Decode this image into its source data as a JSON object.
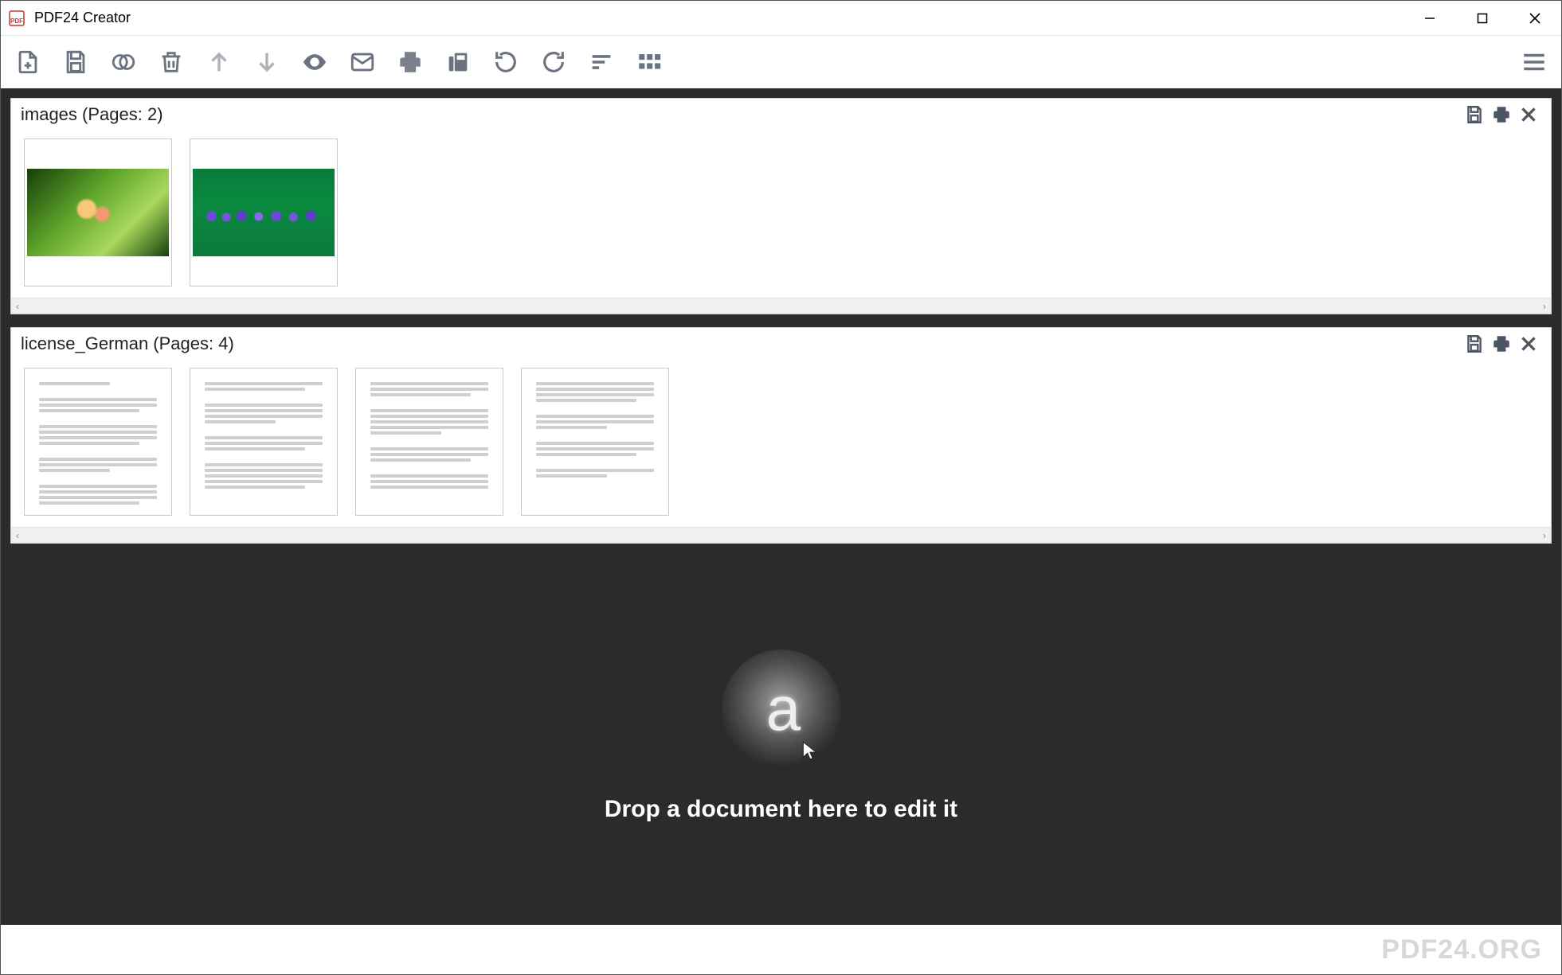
{
  "app": {
    "title": "PDF24 Creator"
  },
  "documents": [
    {
      "title": "images (Pages: 2)",
      "page_count": 2
    },
    {
      "title": "license_German (Pages: 4)",
      "page_count": 4
    }
  ],
  "dropzone": {
    "text": "Drop a document here to edit it"
  },
  "footer": {
    "watermark": "PDF24.ORG"
  }
}
